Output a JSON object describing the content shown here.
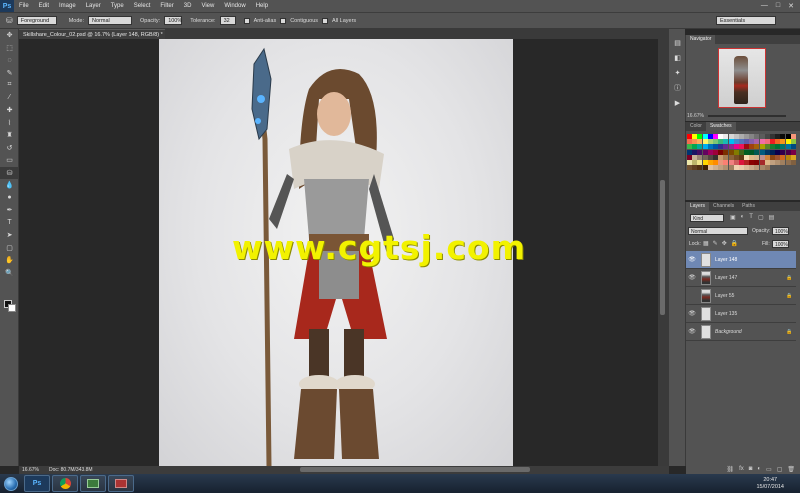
{
  "app": {
    "logo": "Ps"
  },
  "menu": [
    "File",
    "Edit",
    "Image",
    "Layer",
    "Type",
    "Select",
    "Filter",
    "3D",
    "View",
    "Window",
    "Help"
  ],
  "window_controls": {
    "minimize": "—",
    "maximize": "□",
    "close": "✕"
  },
  "options_bar": {
    "fill_source": "Foreground",
    "mode_label": "Mode:",
    "mode_value": "Normal",
    "opacity_label": "Opacity:",
    "opacity_value": "100%",
    "tolerance_label": "Tolerance:",
    "tolerance_value": "32",
    "anti_alias": "Anti-alias",
    "contiguous": "Contiguous",
    "all_layers": "All Layers",
    "workspace": "Essentials"
  },
  "document": {
    "tab_title": "Skillshare_Colour_02.psd @ 16.7% (Layer 148, RGB/8) *",
    "watermark": "www.cgtsj.com"
  },
  "status": {
    "zoom": "16.67%",
    "doc_size": "Doc: 80.7M/343.8M"
  },
  "navigator": {
    "tab": "Navigator",
    "zoom": "16.67%"
  },
  "swatches": {
    "tabs": [
      "Color",
      "Swatches"
    ],
    "colors": [
      "#ff0000",
      "#ffff00",
      "#00ff00",
      "#00ffff",
      "#0000ff",
      "#ff00ff",
      "#ffffff",
      "#ebebeb",
      "#d6d6d6",
      "#c2c2c2",
      "#adadad",
      "#999999",
      "#858585",
      "#707070",
      "#5c5c5c",
      "#474747",
      "#333333",
      "#1f1f1f",
      "#0a0a0a",
      "#000000",
      "#f7977a",
      "#f26c4f",
      "#f68e55",
      "#fbaf5c",
      "#fff467",
      "#acd372",
      "#7cc576",
      "#3bb878",
      "#1abbb4",
      "#00bff3",
      "#438ccb",
      "#5574b9",
      "#605ca8",
      "#855fa8",
      "#a763a8",
      "#f06ea9",
      "#f26d7d",
      "#ed1c24",
      "#f26522",
      "#f7941d",
      "#fff200",
      "#8dc63f",
      "#39b54a",
      "#00a651",
      "#00a99d",
      "#00aeef",
      "#0072bc",
      "#0054a6",
      "#2e3192",
      "#662d91",
      "#92278f",
      "#ec008c",
      "#ed145b",
      "#9e0b0f",
      "#a0410d",
      "#a36209",
      "#aba000",
      "#598527",
      "#197b30",
      "#007236",
      "#00746b",
      "#0076a3",
      "#004b80",
      "#003471",
      "#1b1464",
      "#440e62",
      "#630460",
      "#9e005d",
      "#9e0039",
      "#790000",
      "#7b2e00",
      "#7d4900",
      "#827b00",
      "#406618",
      "#005e20",
      "#005826",
      "#005952",
      "#005b7f",
      "#003663",
      "#002157",
      "#0d004c",
      "#32004b",
      "#4b0049",
      "#7b0046",
      "#7a0026",
      "#c7b299",
      "#998675",
      "#736357",
      "#534741",
      "#37302d",
      "#c69c6d",
      "#a67c52",
      "#8c6239",
      "#754c24",
      "#603913",
      "#f5deb3",
      "#deb887",
      "#d2b48c",
      "#bc8f8f",
      "#cd853f",
      "#8b4513",
      "#a0522d",
      "#d2691e",
      "#b8860b",
      "#daa520",
      "#eee8aa",
      "#bdb76b",
      "#f0e68c",
      "#ffd700",
      "#ffa500",
      "#ff8c00",
      "#e9967a",
      "#fa8072",
      "#f08080",
      "#cd5c5c",
      "#dc143c",
      "#b22222",
      "#8b0000",
      "#800000",
      "#a52a2a",
      "#deb887",
      "#c0a080",
      "#b09070",
      "#a08060",
      "#907050",
      "#806040",
      "#705030",
      "#604020",
      "#503010",
      "#402000",
      "#e0c0a0",
      "#d0b090",
      "#c0a080",
      "#b09070",
      "#a08060",
      "#f0d0b0",
      "#e8c8a8",
      "#d8b898",
      "#c8a888",
      "#b89878",
      "#a88868",
      "#987858"
    ]
  },
  "layers": {
    "tabs": [
      "Layers",
      "Channels",
      "Paths"
    ],
    "kind": "Kind",
    "blend_mode": "Normal",
    "opacity_label": "Opacity:",
    "opacity_value": "100%",
    "lock_label": "Lock:",
    "fill_label": "Fill:",
    "fill_value": "100%",
    "items": [
      {
        "name": "Layer 148",
        "visible": true,
        "selected": true,
        "locked": false
      },
      {
        "name": "Layer 147",
        "visible": true,
        "selected": false,
        "locked": true
      },
      {
        "name": "Layer 55",
        "visible": false,
        "selected": false,
        "locked": true
      },
      {
        "name": "Layer 135",
        "visible": true,
        "selected": false,
        "locked": false
      },
      {
        "name": "Background",
        "visible": true,
        "selected": false,
        "locked": true
      }
    ]
  },
  "taskbar": {
    "apps": [
      {
        "name": "Photoshop",
        "label": "Ps"
      },
      {
        "name": "Chrome",
        "label": ""
      },
      {
        "name": "App3",
        "label": ""
      },
      {
        "name": "App4",
        "label": ""
      }
    ],
    "time": "20:47",
    "date": "15/07/2014"
  }
}
